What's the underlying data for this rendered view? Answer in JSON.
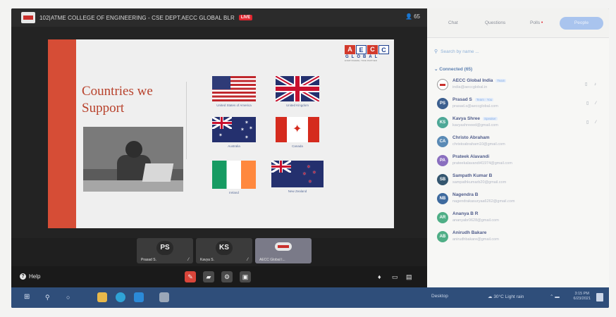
{
  "meeting": {
    "title": "102|ATME COLLEGE OF ENGINEERING - CSE DEPT.AECC GLOBAL BLR",
    "live_badge": "LIVE",
    "participant_count": "65"
  },
  "slide": {
    "title_line1": "Countries we",
    "title_line2": "Support",
    "logo_letters": [
      "A",
      "E",
      "C",
      "C"
    ],
    "logo_word": "GLOBAL",
    "logo_tagline": "EVERYWHERE, TRUE PARTNER",
    "countries": [
      "United States of America",
      "United Kingdom",
      "Australia",
      "Canada",
      "Ireland",
      "New Zealand"
    ]
  },
  "thumbnails": [
    {
      "initials": "PS",
      "name": "Prasad S."
    },
    {
      "initials": "KS",
      "name": "Kavya S."
    },
    {
      "initials": "",
      "name": "AECC Global I..."
    }
  ],
  "controls": {
    "help_label": "Help"
  },
  "panel": {
    "tabs": {
      "chat": "Chat",
      "questions": "Questions",
      "polls": "Polls",
      "people": "People"
    },
    "search_placeholder": "Search by name ...",
    "connected_label": "Connected (65)",
    "people": [
      {
        "initials": "",
        "name": "AECC Global India",
        "badge": "Team",
        "email": "india@aeccglobal.in"
      },
      {
        "initials": "PS",
        "name": "Prasad S",
        "badge": "Team · You",
        "email": "prasad.s@aeccglobal.com"
      },
      {
        "initials": "KS",
        "name": "Kavya Shree",
        "badge": "Speaker",
        "email": "kavyashreeed@gmail.com"
      },
      {
        "initials": "CA",
        "name": "Christo Abraham",
        "badge": "",
        "email": "christoabraham10@gmail.com"
      },
      {
        "initials": "PA",
        "name": "Prateek Alavandi",
        "badge": "",
        "email": "prateekalavandi41974@gmail.com"
      },
      {
        "initials": "SB",
        "name": "Sampath Kumar B",
        "badge": "",
        "email": "sampathkumarb20@gmail.com"
      },
      {
        "initials": "NB",
        "name": "Nagendra B",
        "badge": "",
        "email": "nagendrakasuryaa6262@gmail.com"
      },
      {
        "initials": "AR",
        "name": "Ananya B R",
        "badge": "",
        "email": "ananyabr0628@gmail.com"
      },
      {
        "initials": "AB",
        "name": "Anirudh Bakare",
        "badge": "",
        "email": "anirudhbakare@gmail.com"
      }
    ]
  },
  "taskbar": {
    "desktop_label": "Desktop",
    "weather": "30°C  Light rain",
    "time": "3:15 PM",
    "date": "6/23/2021"
  }
}
